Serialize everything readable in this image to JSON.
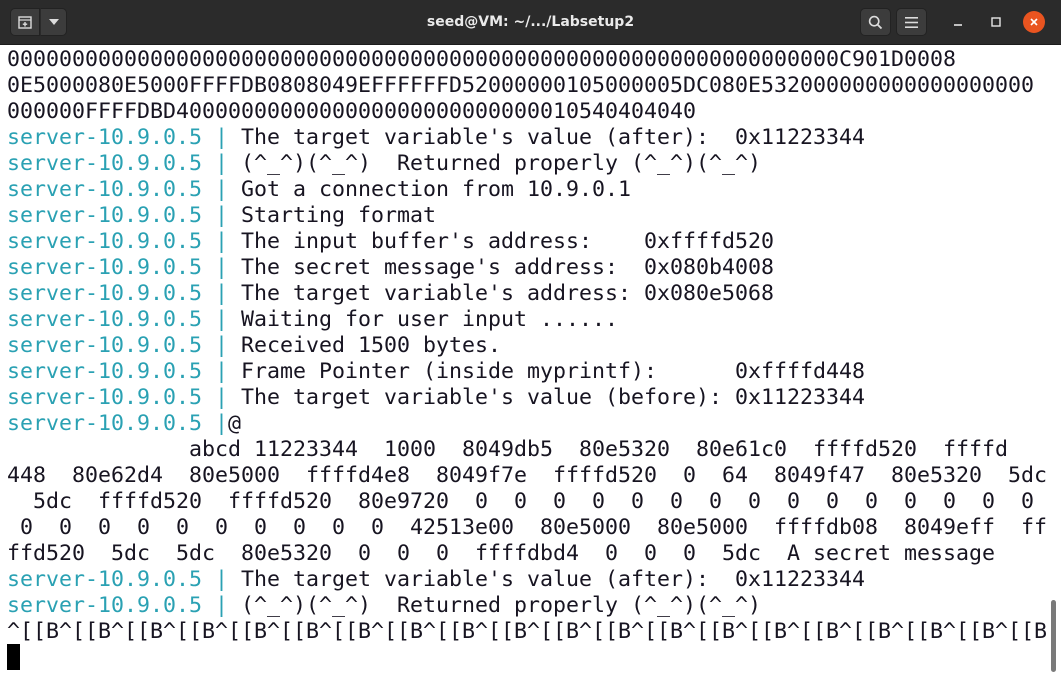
{
  "window": {
    "title": "seed@VM: ~/.../Labsetup2"
  },
  "titlebar_icons": {
    "new_tab": "new-tab-icon",
    "tab_menu": "chevron-down-icon",
    "search": "search-icon",
    "menu": "hamburger-menu-icon",
    "minimize": "minimize-icon",
    "maximize": "maximize-icon",
    "close": "close-icon"
  },
  "colors": {
    "titlebar_bg": "#2b2b2b",
    "terminal_bg": "#ffffff",
    "terminal_fg": "#171421",
    "prompt_cyan": "#2aa1b3",
    "close_button": "#e95420"
  },
  "terminal": {
    "prefix": "server-10.9.0.5",
    "separator": " | ",
    "lines": [
      {
        "text": "0000000000000000000000000000000000000000000000000000000000000000C901D0008"
      },
      {
        "text": "0E5000080E5000FFFFDB0808049EFFFFFFD52000000105000005DC080E532000000000000000000"
      },
      {
        "text": "000000FFFFDBD4000000000000000000000000000010540404040"
      },
      {
        "server": "server-10.9.0.5",
        "sep": " | ",
        "msg": "The target variable's value (after):  0x11223344"
      },
      {
        "server": "server-10.9.0.5",
        "sep": " | ",
        "msg": "(^_^)(^_^)  Returned properly (^_^)(^_^)"
      },
      {
        "server": "server-10.9.0.5",
        "sep": " | ",
        "msg": "Got a connection from 10.9.0.1"
      },
      {
        "server": "server-10.9.0.5",
        "sep": " | ",
        "msg": "Starting format"
      },
      {
        "server": "server-10.9.0.5",
        "sep": " | ",
        "msg": "The input buffer's address:    0xffffd520"
      },
      {
        "server": "server-10.9.0.5",
        "sep": " | ",
        "msg": "The secret message's address:  0x080b4008"
      },
      {
        "server": "server-10.9.0.5",
        "sep": " | ",
        "msg": "The target variable's address: 0x080e5068"
      },
      {
        "server": "server-10.9.0.5",
        "sep": " | ",
        "msg": "Waiting for user input ......"
      },
      {
        "server": "server-10.9.0.5",
        "sep": " | ",
        "msg": "Received 1500 bytes."
      },
      {
        "server": "server-10.9.0.5",
        "sep": " | ",
        "msg": "Frame Pointer (inside myprintf):      0xffffd448"
      },
      {
        "server": "server-10.9.0.5",
        "sep": " | ",
        "msg": "The target variable's value (before): 0x11223344"
      },
      {
        "server": "server-10.9.0.5",
        "sep": " |",
        "msg": "@"
      },
      {
        "text": "              abcd 11223344  1000  8049db5  80e5320  80e61c0  ffffd520  ffffd"
      },
      {
        "text": "448  80e62d4  80e5000  ffffd4e8  8049f7e  ffffd520  0  64  8049f47  80e5320  5dc"
      },
      {
        "text": "  5dc  ffffd520  ffffd520  80e9720  0  0  0  0  0  0  0  0  0  0  0  0  0  0  0"
      },
      {
        "text": " 0  0  0  0  0  0  0  0  0  0  42513e00  80e5000  80e5000  ffffdb08  8049eff  ff"
      },
      {
        "text": "ffd520  5dc  5dc  80e5320  0  0  0  ffffdbd4  0  0  0  5dc  A secret message"
      },
      {
        "server": "server-10.9.0.5",
        "sep": " | ",
        "msg": "The target variable's value (after):  0x11223344"
      },
      {
        "server": "server-10.9.0.5",
        "sep": " | ",
        "msg": "(^_^)(^_^)  Returned properly (^_^)(^_^)"
      },
      {
        "text": "^[[B^[[B^[[B^[[B^[[B^[[B^[[B^[[B^[[B^[[B^[[B^[[B^[[B^[[B^[[B^[[B^[[B^[[B^[[B^[[B"
      }
    ]
  }
}
